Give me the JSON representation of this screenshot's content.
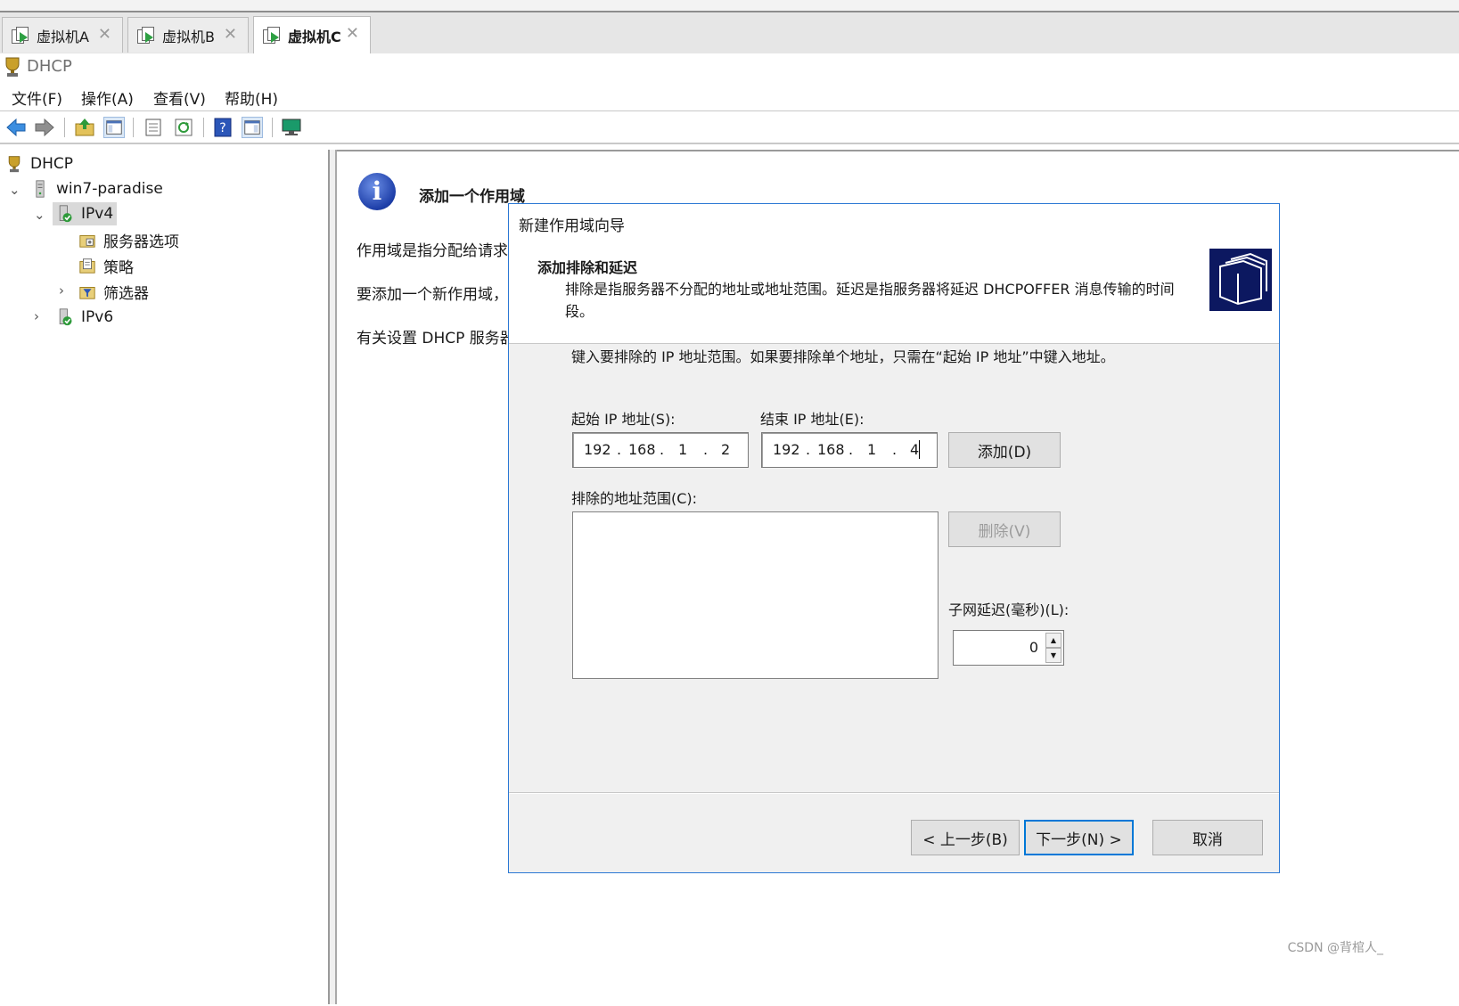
{
  "tabs": [
    {
      "label": "虚拟机A"
    },
    {
      "label": "虚拟机B"
    },
    {
      "label": "虚拟机C"
    }
  ],
  "app_title": "DHCP",
  "menu": {
    "file": "文件(F)",
    "action": "操作(A)",
    "view": "查看(V)",
    "help": "帮助(H)"
  },
  "tree": {
    "root": "DHCP",
    "server": "win7-paradise",
    "ipv4": "IPv4",
    "server_options": "服务器选项",
    "policies": "策略",
    "filters": "筛选器",
    "ipv6": "IPv6"
  },
  "right": {
    "heading": "添加一个作用域",
    "para1": "作用域是指分配给请求",
    "para2": "要添加一个新作用域，",
    "para3": "有关设置 DHCP 服务器"
  },
  "dialog": {
    "title": "新建作用域向导",
    "header_title": "添加排除和延迟",
    "header_desc": "排除是指服务器不分配的地址或地址范围。延迟是指服务器将延迟 DHCPOFFER 消息传输的时间段。",
    "instruction": "键入要排除的 IP 地址范围。如果要排除单个地址，只需在“起始 IP 地址”中键入地址。",
    "start_ip_label": "起始 IP 地址(S):",
    "end_ip_label": "结束 IP 地址(E):",
    "start_ip": {
      "o1": "192",
      "o2": "168",
      "o3": "1",
      "o4": "2"
    },
    "end_ip": {
      "o1": "192",
      "o2": "168",
      "o3": "1",
      "o4": "4"
    },
    "add_button": "添加(D)",
    "excluded_label": "排除的地址范围(C):",
    "remove_button": "删除(V)",
    "delay_label": "子网延迟(毫秒)(L):",
    "delay_value": "0",
    "back_button": "< 上一步(B)",
    "next_button": "下一步(N) >",
    "cancel_button": "取消"
  },
  "watermark": "CSDN @背棺人_",
  "colors": {
    "accent": "#0078d7",
    "dialog_border": "#2b78d4",
    "wizard_image_bg": "#0c1860"
  }
}
